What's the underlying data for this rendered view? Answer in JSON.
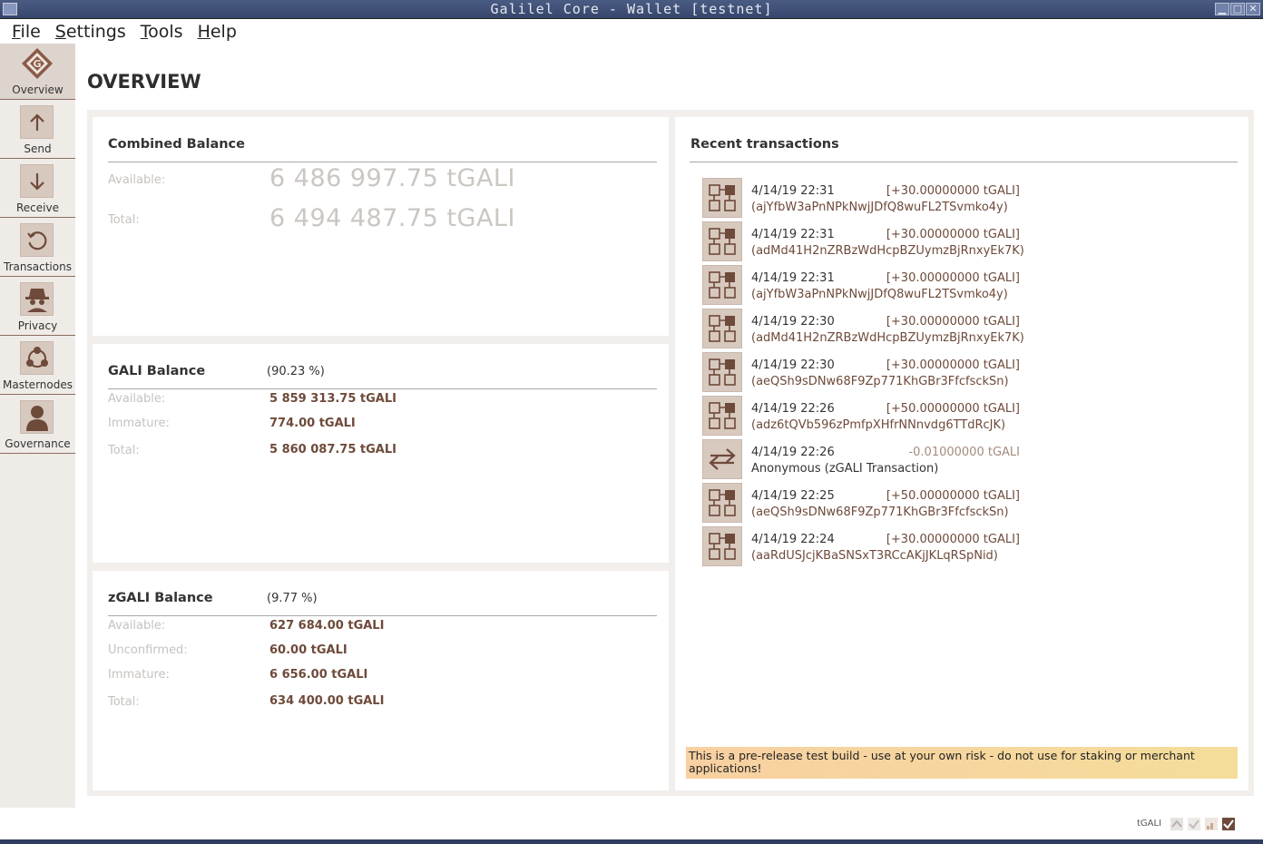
{
  "window": {
    "title": "Galilel Core - Wallet [testnet]",
    "buttons": [
      "▁",
      "□",
      "✕"
    ]
  },
  "menu": [
    {
      "first": "F",
      "rest": "ile"
    },
    {
      "first": "S",
      "rest": "ettings"
    },
    {
      "first": "T",
      "rest": "ools"
    },
    {
      "first": "H",
      "rest": "elp"
    }
  ],
  "sidebar": {
    "items": [
      {
        "label": "Overview",
        "icon": "galilel-logo-icon",
        "active": true
      },
      {
        "label": "Send",
        "icon": "arrow-up-icon"
      },
      {
        "label": "Receive",
        "icon": "arrow-down-icon"
      },
      {
        "label": "Transactions",
        "icon": "history-icon"
      },
      {
        "label": "Privacy",
        "icon": "spy-icon"
      },
      {
        "label": "Masternodes",
        "icon": "network-icon"
      },
      {
        "label": "Governance",
        "icon": "person-icon"
      }
    ]
  },
  "page": {
    "title": "OVERVIEW"
  },
  "combined": {
    "heading": "Combined Balance",
    "available_label": "Available:",
    "available_value": "6 486 997.75 tGALI",
    "total_label": "Total:",
    "total_value": "6 494 487.75 tGALI"
  },
  "gali": {
    "heading": "GALI Balance",
    "percent": "(90.23 %)",
    "available_label": "Available:",
    "available_value": "5 859 313.75 tGALI",
    "immature_label": "Immature:",
    "immature_value": "774.00 tGALI",
    "total_label": "Total:",
    "total_value": "5 860 087.75 tGALI"
  },
  "zgali": {
    "heading": "zGALI Balance",
    "percent": "(9.77 %)",
    "available_label": "Available:",
    "available_value": "627 684.00 tGALI",
    "unconfirmed_label": "Unconfirmed:",
    "unconfirmed_value": "60.00 tGALI",
    "immature_label": "Immature:",
    "immature_value": "6 656.00 tGALI",
    "total_label": "Total:",
    "total_value": "634 400.00 tGALI"
  },
  "recent": {
    "heading": "Recent transactions",
    "items": [
      {
        "date": "4/14/19 22:31",
        "amount": "[+30.00000000 tGALI]",
        "address": "(ajYfbW3aPnNPkNwjJDfQ8wuFL2TSvmko4y)",
        "type": "mined"
      },
      {
        "date": "4/14/19 22:31",
        "amount": "[+30.00000000 tGALI]",
        "address": "(adMd41H2nZRBzWdHcpBZUymzBjRnxyEk7K)",
        "type": "mined"
      },
      {
        "date": "4/14/19 22:31",
        "amount": "[+30.00000000 tGALI]",
        "address": "(ajYfbW3aPnNPkNwjJDfQ8wuFL2TSvmko4y)",
        "type": "mined"
      },
      {
        "date": "4/14/19 22:30",
        "amount": "[+30.00000000 tGALI]",
        "address": "(adMd41H2nZRBzWdHcpBZUymzBjRnxyEk7K)",
        "type": "mined"
      },
      {
        "date": "4/14/19 22:30",
        "amount": "[+30.00000000 tGALI]",
        "address": "(aeQSh9sDNw68F9Zp771KhGBr3FfcfsckSn)",
        "type": "mined"
      },
      {
        "date": "4/14/19 22:26",
        "amount": "[+50.00000000 tGALI]",
        "address": "(adz6tQVb596zPmfpXHfrNNnvdg6TTdRcJK)",
        "type": "mined"
      },
      {
        "date": "4/14/19 22:26",
        "amount": "-0.01000000 tGALI",
        "address": "Anonymous (zGALI Transaction)",
        "type": "transfer"
      },
      {
        "date": "4/14/19 22:25",
        "amount": "[+50.00000000 tGALI]",
        "address": "(aeQSh9sDNw68F9Zp771KhGBr3FfcfsckSn)",
        "type": "mined"
      },
      {
        "date": "4/14/19 22:24",
        "amount": "[+30.00000000 tGALI]",
        "address": "(aaRdUSJcjKBaSNSxT3RCcAKjJKLqRSpNid)",
        "type": "mined"
      }
    ]
  },
  "warning": "This is a pre-release test build - use at your own risk - do not use for staking or merchant applications!",
  "statusbar": {
    "unit": "tGALI"
  },
  "colors": {
    "accent": "#6e4a3a",
    "sidebar": "#efece8",
    "icon_bg": "#d8c9bf",
    "warning": "#f6d69e",
    "titlebar": "#3f4e76"
  }
}
